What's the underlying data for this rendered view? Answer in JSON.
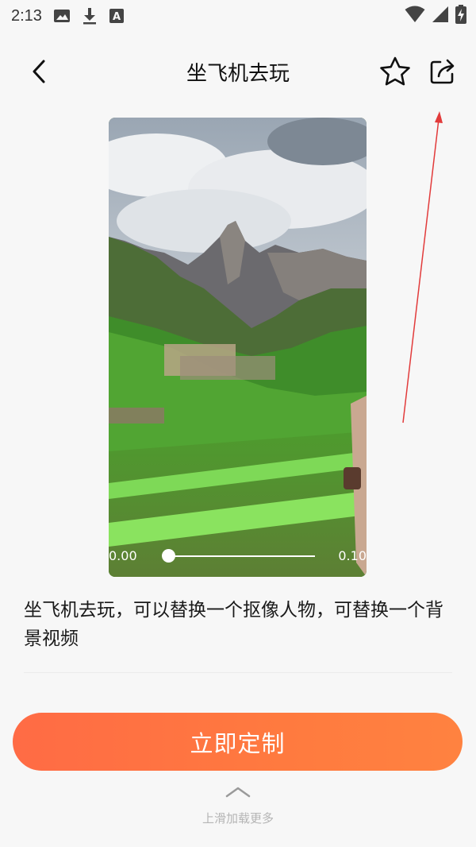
{
  "status_bar": {
    "time": "2:13",
    "left_icons": [
      "image-icon",
      "download-icon",
      "keyboard-a-icon"
    ],
    "right_icons": [
      "wifi-icon",
      "cellular-signal-icon",
      "battery-charging-icon"
    ]
  },
  "header": {
    "title": "坐飞机去玩",
    "back_icon": "chevron-left-icon",
    "favorite_icon": "star-outline-icon",
    "share_icon": "share-icon"
  },
  "video": {
    "current_time": "0.00",
    "duration": "0.10",
    "progress": 0.0
  },
  "description": "坐飞机去玩，可以替换一个抠像人物，可替换一个背景视频",
  "cta": {
    "label": "立即定制",
    "gradient_start": "#ff6b45",
    "gradient_end": "#ff8240"
  },
  "footer": {
    "swipe_icon": "chevron-up-icon",
    "load_more": "上滑加载更多"
  },
  "colors": {
    "background": "#f7f7f7",
    "accent": "#ff7340",
    "annotation_arrow": "#e23b3b"
  }
}
